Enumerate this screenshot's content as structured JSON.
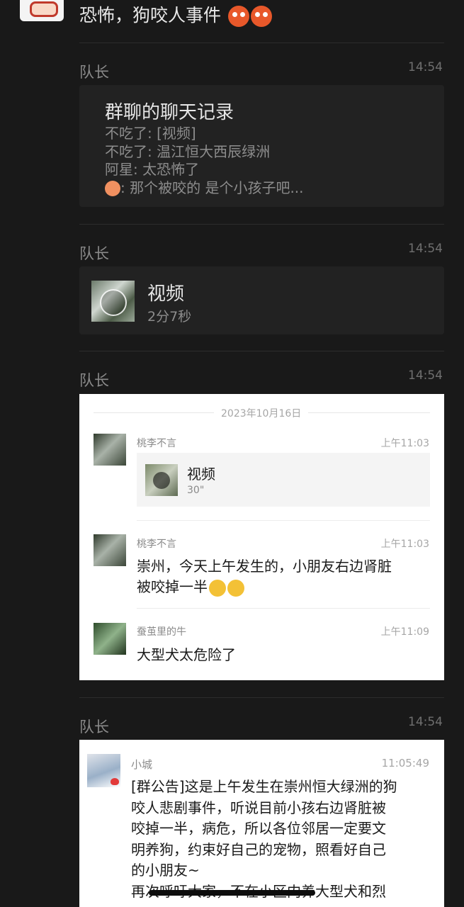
{
  "top_message": {
    "text": "恐怖，狗咬人事件"
  },
  "messages": [
    {
      "sender": "队长",
      "time": "14:54",
      "chat_record": {
        "title": "群聊的聊天记录",
        "lines": [
          "不吃了: [视频]",
          "不吃了: 温江恒大西辰绿洲",
          "阿星: 太恐怖了",
          ": 那个被咬的 是个小孩子吧..."
        ]
      }
    },
    {
      "sender": "队长",
      "time": "14:54",
      "video": {
        "title": "视频",
        "duration": "2分7秒"
      }
    },
    {
      "sender": "队长",
      "time": "14:54",
      "screenshot": {
        "date": "2023年10月16日",
        "items": [
          {
            "name": "桃李不言",
            "time": "上午11:03",
            "video_title": "视频",
            "video_duration": "30\""
          },
          {
            "name": "桃李不言",
            "time": "上午11:03",
            "text_line1": "崇州，今天上午发生的，小朋友右边肾脏",
            "text_line2": "被咬掉一半"
          },
          {
            "name": "蚕茧里的牛",
            "time": "上午11:09",
            "text": "大型犬太危险了"
          }
        ]
      }
    },
    {
      "sender": "队长",
      "time": "14:54",
      "announcement": {
        "name": "小城",
        "time": "11:05:49",
        "lines": [
          "[群公告]这是上午发生在崇州恒大绿洲的狗",
          "咬人悲剧事件，听说目前小孩右边肾脏被",
          "咬掉一半，病危，所以各位邻居一定要文",
          "明养狗，约束好自己的宠物，照看好自己",
          "的小朋友~",
          "再次呼吁大家，不在小区内养大型犬和烈"
        ]
      }
    }
  ],
  "colors": {
    "background": "#191919",
    "card": "#222222",
    "secondary_text": "#8a8a8a"
  }
}
